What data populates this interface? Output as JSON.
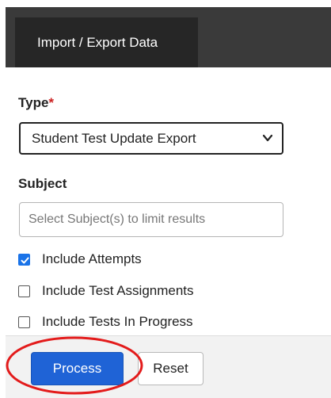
{
  "header": {
    "tab_label": "Import / Export Data"
  },
  "form": {
    "type": {
      "label": "Type",
      "required_marker": "*",
      "selected_value": "Student Test Update Export"
    },
    "subject": {
      "label": "Subject",
      "placeholder": "Select Subject(s) to limit results"
    },
    "options": [
      {
        "label": "Include Attempts",
        "checked": true
      },
      {
        "label": "Include Test Assignments",
        "checked": false
      },
      {
        "label": "Include Tests In Progress",
        "checked": false
      }
    ]
  },
  "actions": {
    "process_label": "Process",
    "reset_label": "Reset"
  },
  "colors": {
    "header_bar": "#3a3a3a",
    "active_tab": "#262626",
    "primary_button": "#1f63d6",
    "checkbox_checked": "#1a73e8",
    "annotation_circle": "#e31b1b",
    "required_marker": "#cc2222"
  },
  "icons": {
    "select_chevron": "chevron-down-icon",
    "checkmark": "checkmark-icon"
  }
}
